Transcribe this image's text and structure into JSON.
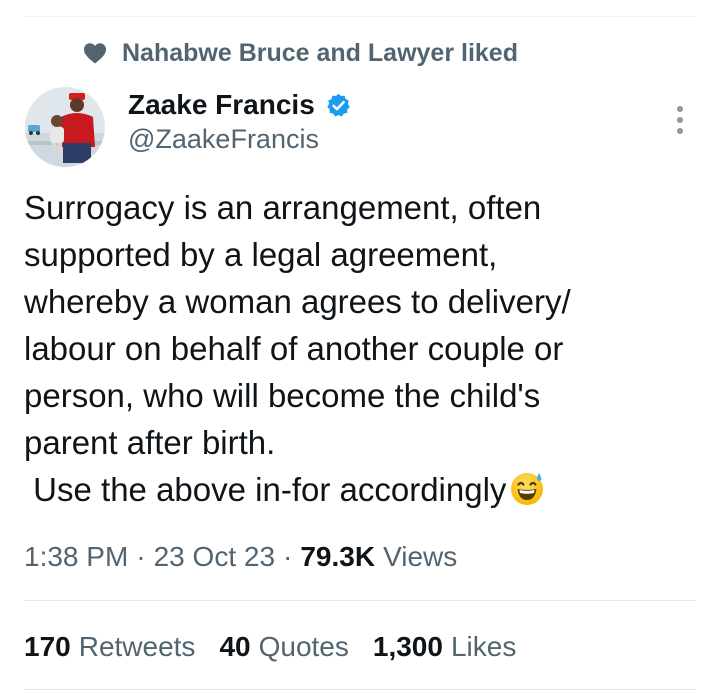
{
  "social_context": {
    "icon": "heart-icon",
    "text": "Nahabwe Bruce and Lawyer liked"
  },
  "author": {
    "avatar_icon": "avatar-photo",
    "display_name": "Zaake Francis",
    "verified_icon": "verified-badge-icon",
    "handle": "@ZaakeFrancis"
  },
  "more_icon": "more-vertical-icon",
  "tweet": {
    "text": "Surrogacy is an arrangement, often\nsupported by a legal agreement,\nwhereby a woman agrees to delivery/\nlabour on behalf of another couple or\nperson, who will become the child's\nparent after birth.\n Use the above in-for accordingly",
    "emoji_icon": "grinning-sweat-emoji"
  },
  "meta": {
    "time": "1:38 PM",
    "separator": "·",
    "date": "23 Oct 23",
    "views_count": "79.3K",
    "views_label": "Views"
  },
  "stats": {
    "retweets_count": "170",
    "retweets_label": "Retweets",
    "quotes_count": "40",
    "quotes_label": "Quotes",
    "likes_count": "1,300",
    "likes_label": "Likes"
  },
  "colors": {
    "primary_text": "#0f1419",
    "secondary_text": "#536471",
    "verified_blue": "#1d9bf0",
    "divider": "#e1e8ed"
  }
}
